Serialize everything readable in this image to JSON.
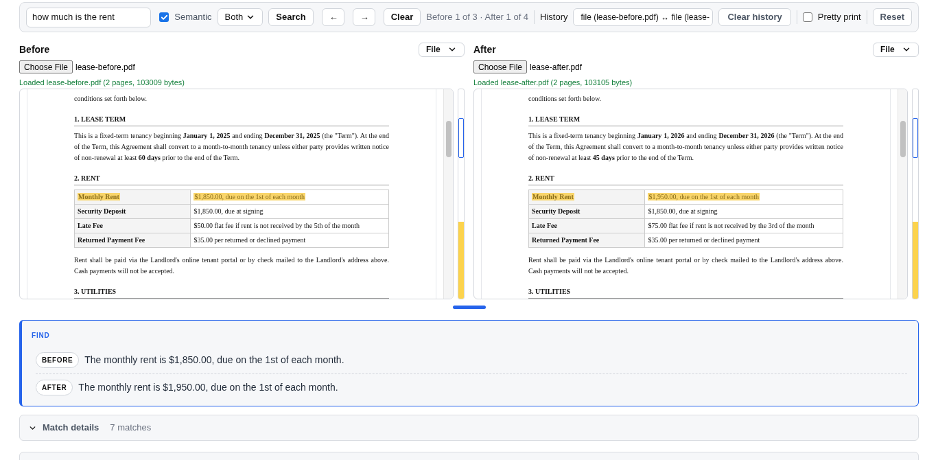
{
  "toolbar": {
    "query": "how much is the rent",
    "semantic": {
      "label": "Semantic",
      "checked": true
    },
    "scope": "Both",
    "search": "Search",
    "prev": "←",
    "next": "→",
    "clear": "Clear",
    "status": "Before 1 of 3 · After 1 of 4",
    "history_label": "History",
    "history": "file (lease-before.pdf) ↔ file (lease-",
    "clear_history": "Clear history",
    "pretty_print": {
      "label": "Pretty print",
      "checked": false
    },
    "reset": "Reset"
  },
  "panes": [
    {
      "title": "Before",
      "source": "File",
      "choose": "Choose File",
      "file_name": "lease-before.pdf",
      "status": "Loaded lease-before.pdf (2 pages, 103009 bytes)",
      "document": [
        {
          "kind": "paragraph",
          "text": "conditions set forth below."
        },
        {
          "kind": "heading",
          "text": "1. LEASE TERM"
        },
        {
          "kind": "paragraph",
          "text": "This is a fixed-term tenancy beginning **January 1, 2025** and ending **December 31, 2025** (the \"Term\"). At the end of the Term, this Agreement shall convert to a month-to-month tenancy unless either party provides written notice of non-renewal at least **60 days** prior to the end of the Term."
        },
        {
          "kind": "heading",
          "text": "2. RENT"
        },
        {
          "kind": "table",
          "rows": [
            {
              "label": "Monthly Rent",
              "value": "$1,850.00, due on the 1st of each month",
              "highlighted": true
            },
            {
              "label": "Security Deposit",
              "value": "$1,850.00, due at signing",
              "highlighted": false
            },
            {
              "label": "Late Fee",
              "value": "$50.00 flat fee if rent is not received by the 5th of the month",
              "highlighted": false
            },
            {
              "label": "Returned Payment Fee",
              "value": "$35.00 per returned or declined payment",
              "highlighted": false
            }
          ]
        },
        {
          "kind": "paragraph",
          "text": "Rent shall be paid via the Landlord's online tenant portal or by check mailed to the Landlord's address above. Cash payments will not be accepted."
        },
        {
          "kind": "heading",
          "text": "3. UTILITIES"
        }
      ]
    },
    {
      "title": "After",
      "source": "File",
      "choose": "Choose File",
      "file_name": "lease-after.pdf",
      "status": "Loaded lease-after.pdf (2 pages, 103105 bytes)",
      "document": [
        {
          "kind": "paragraph",
          "text": "conditions set forth below."
        },
        {
          "kind": "heading",
          "text": "1. LEASE TERM"
        },
        {
          "kind": "paragraph",
          "text": "This is a fixed-term tenancy beginning **January 1, 2026** and ending **December 31, 2026** (the \"Term\"). At the end of the Term, this Agreement shall convert to a month-to-month tenancy unless either party provides written notice of non-renewal at least **45 days** prior to the end of the Term."
        },
        {
          "kind": "heading",
          "text": "2. RENT"
        },
        {
          "kind": "table",
          "rows": [
            {
              "label": "Monthly Rent",
              "value": "$1,950.00, due on the 1st of each month",
              "highlighted": true
            },
            {
              "label": "Security Deposit",
              "value": "$1,850.00, due at signing",
              "highlighted": false
            },
            {
              "label": "Late Fee",
              "value": "$75.00 flat fee if rent is not received by the 3rd of the month",
              "highlighted": false
            },
            {
              "label": "Returned Payment Fee",
              "value": "$35.00 per returned or declined payment",
              "highlighted": false
            }
          ]
        },
        {
          "kind": "paragraph",
          "text": "Rent shall be paid via the Landlord's online tenant portal or by check mailed to the Landlord's address above. Cash payments will not be accepted."
        },
        {
          "kind": "heading",
          "text": "3. UTILITIES"
        }
      ]
    }
  ],
  "find": {
    "title": "FIND",
    "results": [
      {
        "tag": "BEFORE",
        "text": "The monthly rent is $1,850.00, due on the 1st of each month."
      },
      {
        "tag": "AFTER",
        "text": "The monthly rent is $1,950.00, due on the 1st of each month."
      }
    ]
  },
  "match_details": {
    "label": "Match details",
    "count": "7 matches",
    "expanded": false
  }
}
